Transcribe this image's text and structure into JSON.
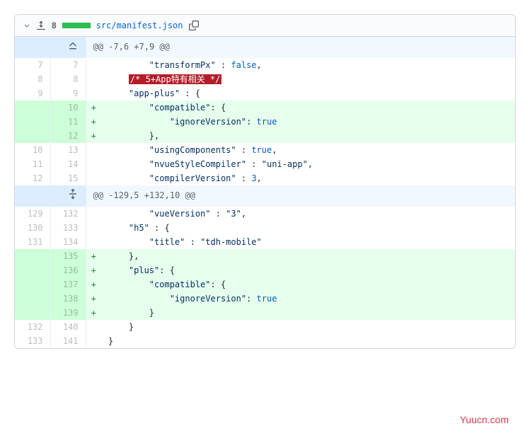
{
  "file_header": {
    "change_count": "8",
    "file_path": "src/manifest.json"
  },
  "hunks": [
    {
      "header": "@@ -7,6 +7,9 @@",
      "expand_type": "up",
      "rows": [
        {
          "old": "7",
          "new": "7",
          "marker": "",
          "type": "context",
          "html": "        <span class='kw-str'>\"transformPx\"</span> : <span class='kw-false'>false</span>,"
        },
        {
          "old": "8",
          "new": "8",
          "marker": "",
          "type": "context",
          "html": "    <span class='highlight-red'>/* 5+App特有相关 */</span>"
        },
        {
          "old": "9",
          "new": "9",
          "marker": "",
          "type": "context",
          "html": "    <span class='kw-str'>\"app-plus\"</span> : {"
        },
        {
          "old": "",
          "new": "10",
          "marker": "+",
          "type": "addition",
          "html": "        <span class='kw-str'>\"compatible\"</span>: {"
        },
        {
          "old": "",
          "new": "11",
          "marker": "+",
          "type": "addition",
          "html": "            <span class='kw-str'>\"ignoreVersion\"</span>: <span class='kw-true'>true</span>"
        },
        {
          "old": "",
          "new": "12",
          "marker": "+",
          "type": "addition",
          "html": "        },"
        },
        {
          "old": "10",
          "new": "13",
          "marker": "",
          "type": "context",
          "html": "        <span class='kw-str'>\"usingComponents\"</span> : <span class='kw-true'>true</span>,"
        },
        {
          "old": "11",
          "new": "14",
          "marker": "",
          "type": "context",
          "html": "        <span class='kw-str'>\"nvueStyleCompiler\"</span> : <span class='kw-str'>\"uni-app\"</span>,"
        },
        {
          "old": "12",
          "new": "15",
          "marker": "",
          "type": "context",
          "html": "        <span class='kw-str'>\"compilerVersion\"</span> : <span class='kw-num'>3</span>,"
        }
      ]
    },
    {
      "header": "@@ -129,5 +132,10 @@",
      "expand_type": "both",
      "rows": [
        {
          "old": "129",
          "new": "132",
          "marker": "",
          "type": "context",
          "html": "        <span class='kw-str'>\"vueVersion\"</span> : <span class='kw-str'>\"3\"</span>,"
        },
        {
          "old": "130",
          "new": "133",
          "marker": "",
          "type": "context",
          "html": "    <span class='kw-str'>\"h5\"</span> : {"
        },
        {
          "old": "131",
          "new": "134",
          "marker": "",
          "type": "context",
          "html": "        <span class='kw-str'>\"title\"</span> : <span class='kw-str'>\"tdh-mobile\"</span>"
        },
        {
          "old": "",
          "new": "135",
          "marker": "+",
          "type": "addition",
          "html": "    },"
        },
        {
          "old": "",
          "new": "136",
          "marker": "+",
          "type": "addition",
          "html": "    <span class='kw-str'>\"plus\"</span>: {"
        },
        {
          "old": "",
          "new": "137",
          "marker": "+",
          "type": "addition",
          "html": "        <span class='kw-str'>\"compatible\"</span>: {"
        },
        {
          "old": "",
          "new": "138",
          "marker": "+",
          "type": "addition",
          "html": "            <span class='kw-str'>\"ignoreVersion\"</span>: <span class='kw-true'>true</span>"
        },
        {
          "old": "",
          "new": "139",
          "marker": "+",
          "type": "addition",
          "html": "        }"
        },
        {
          "old": "132",
          "new": "140",
          "marker": "",
          "type": "context",
          "html": "    }"
        },
        {
          "old": "133",
          "new": "141",
          "marker": "",
          "type": "context",
          "html": "}"
        }
      ]
    }
  ],
  "watermark": "Yuucn.com"
}
